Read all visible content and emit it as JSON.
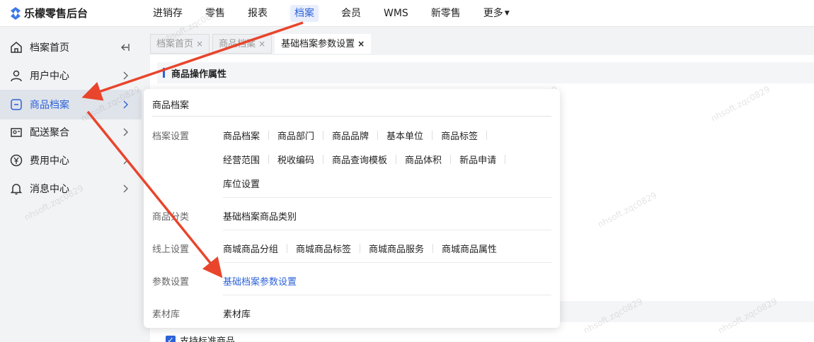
{
  "brand": {
    "name": "乐檬零售后台"
  },
  "topnav": [
    {
      "label": "进销存",
      "active": false
    },
    {
      "label": "零售",
      "active": false
    },
    {
      "label": "报表",
      "active": false
    },
    {
      "label": "档案",
      "active": true
    },
    {
      "label": "会员",
      "active": false
    },
    {
      "label": "WMS",
      "active": false
    },
    {
      "label": "新零售",
      "active": false
    },
    {
      "label": "更多",
      "active": false
    }
  ],
  "sidebar": {
    "items": [
      {
        "label": "档案首页",
        "icon": "home-icon"
      },
      {
        "label": "用户中心",
        "icon": "user-icon"
      },
      {
        "label": "商品档案",
        "icon": "product-icon",
        "active": true
      },
      {
        "label": "配送聚合",
        "icon": "delivery-icon"
      },
      {
        "label": "费用中心",
        "icon": "yen-icon"
      },
      {
        "label": "消息中心",
        "icon": "bell-icon"
      }
    ]
  },
  "tabs": [
    {
      "label": "档案首页"
    },
    {
      "label": "商品档案"
    },
    {
      "label": "基础档案参数设置",
      "active": true
    }
  ],
  "tab_close_glyph": "×",
  "main": {
    "section_title": "商品操作属性",
    "checkbox_label": "支持标准商品",
    "checkbox_mark": "✓"
  },
  "panel": {
    "title": "商品档案",
    "groups": [
      {
        "label": "档案设置",
        "rows": [
          [
            "商品档案",
            "商品部门",
            "商品品牌",
            "基本单位",
            "商品标签"
          ],
          [
            "经营范围",
            "税收编码",
            "商品查询模板",
            "商品体积",
            "新品申请"
          ],
          [
            "库位设置"
          ]
        ]
      },
      {
        "label": "商品分类",
        "rows": [
          [
            "基础档案商品类别"
          ]
        ]
      },
      {
        "label": "线上设置",
        "rows": [
          [
            "商城商品分组",
            "商城商品标签",
            "商城商品服务",
            "商城商品属性"
          ]
        ]
      },
      {
        "label": "参数设置",
        "rows": [
          [
            "基础档案参数设置"
          ]
        ]
      },
      {
        "label": "素材库",
        "rows": [
          [
            "素材库"
          ]
        ]
      }
    ]
  },
  "watermark": "nhsoft.zqc0829",
  "colors": {
    "accent": "#2c63d8",
    "arrow": "#e8452c",
    "sidebar_active_bg": "#dfe3ea"
  }
}
